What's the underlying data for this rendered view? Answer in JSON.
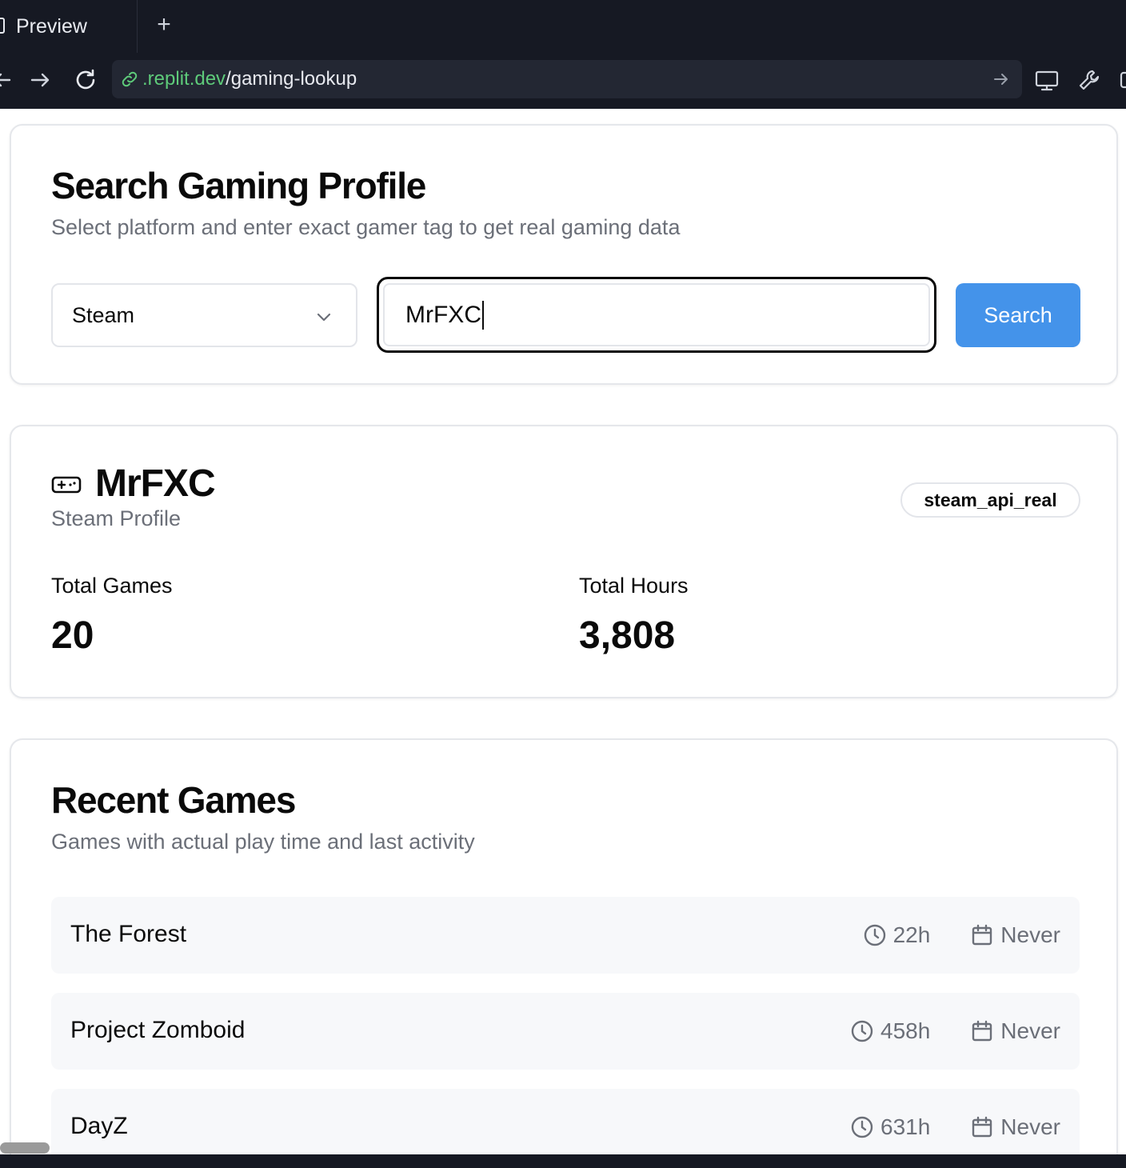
{
  "browser": {
    "tab_title": "Preview",
    "new_tab": "+",
    "url_host": ".replit.dev",
    "url_path": "/gaming-lookup"
  },
  "search_card": {
    "title": "Search Gaming Profile",
    "subtitle": "Select platform and enter exact gamer tag to get real gaming data",
    "platform_selected": "Steam",
    "gamer_tag_value": "MrFXC",
    "search_label": "Search"
  },
  "profile": {
    "name": "MrFXC",
    "platform_label": "Steam Profile",
    "source_badge": "steam_api_real",
    "total_games_label": "Total Games",
    "total_games": "20",
    "total_hours_label": "Total Hours",
    "total_hours": "3,808"
  },
  "recent_games": {
    "title": "Recent Games",
    "subtitle": "Games with actual play time and last activity",
    "items": [
      {
        "name": "The Forest",
        "hours": "22h",
        "last_played": "Never"
      },
      {
        "name": "Project Zomboid",
        "hours": "458h",
        "last_played": "Never"
      },
      {
        "name": "DayZ",
        "hours": "631h",
        "last_played": "Never"
      }
    ]
  },
  "colors": {
    "accent": "#4493ea",
    "chrome_bg": "#161923",
    "url_host": "#5ecb7a",
    "muted_text": "#6b6f78",
    "row_bg": "#f7f8fa"
  },
  "icons": {
    "nav": [
      "back-arrow-icon",
      "forward-arrow-icon",
      "reload-icon",
      "link-icon",
      "go-arrow-icon",
      "monitor-icon",
      "wrench-icon"
    ],
    "profile": "gamepad-icon",
    "game_hours": "clock-icon",
    "game_last_played": "calendar-icon",
    "select": "chevron-down-icon"
  }
}
